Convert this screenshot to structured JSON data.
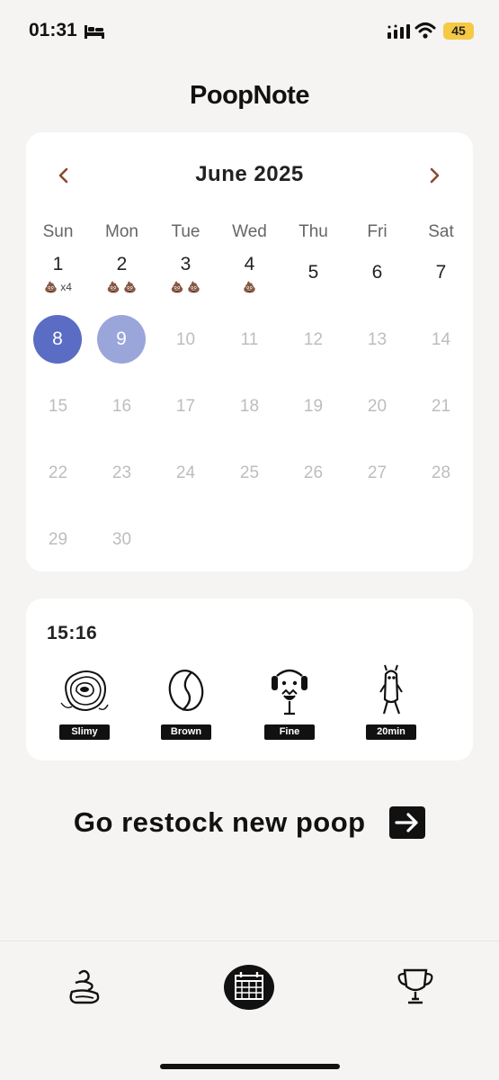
{
  "status_bar": {
    "time": "01:31",
    "battery": "45"
  },
  "app": {
    "title": "PoopNote"
  },
  "calendar": {
    "month_title": "June 2025",
    "weekdays": [
      "Sun",
      "Mon",
      "Tue",
      "Wed",
      "Thu",
      "Fri",
      "Sat"
    ],
    "days": [
      {
        "n": "1",
        "marks": "💩 x4"
      },
      {
        "n": "2",
        "marks": "💩 💩"
      },
      {
        "n": "3",
        "marks": "💩 💩"
      },
      {
        "n": "4",
        "marks": "💩"
      },
      {
        "n": "5"
      },
      {
        "n": "6"
      },
      {
        "n": "7"
      },
      {
        "n": "8"
      },
      {
        "n": "9"
      },
      {
        "n": "10"
      },
      {
        "n": "11"
      },
      {
        "n": "12"
      },
      {
        "n": "13"
      },
      {
        "n": "14"
      },
      {
        "n": "15"
      },
      {
        "n": "16"
      },
      {
        "n": "17"
      },
      {
        "n": "18"
      },
      {
        "n": "19"
      },
      {
        "n": "20"
      },
      {
        "n": "21"
      },
      {
        "n": "22"
      },
      {
        "n": "23"
      },
      {
        "n": "24"
      },
      {
        "n": "25"
      },
      {
        "n": "26"
      },
      {
        "n": "27"
      },
      {
        "n": "28"
      },
      {
        "n": "29"
      },
      {
        "n": "30"
      }
    ],
    "today_color": "#5b6cc4",
    "selected_color": "#9aa6da"
  },
  "entry": {
    "time": "15:16",
    "attributes": [
      {
        "icon": "slimy-icon",
        "label": "Slimy"
      },
      {
        "icon": "brown-bean-icon",
        "label": "Brown"
      },
      {
        "icon": "fine-face-icon",
        "label": "Fine"
      },
      {
        "icon": "duration-figure-icon",
        "label": "20min"
      }
    ]
  },
  "restock": {
    "label": "Go restock new poop"
  },
  "tabs": [
    {
      "icon": "poop-icon"
    },
    {
      "icon": "calendar-icon"
    },
    {
      "icon": "trophy-icon"
    }
  ]
}
